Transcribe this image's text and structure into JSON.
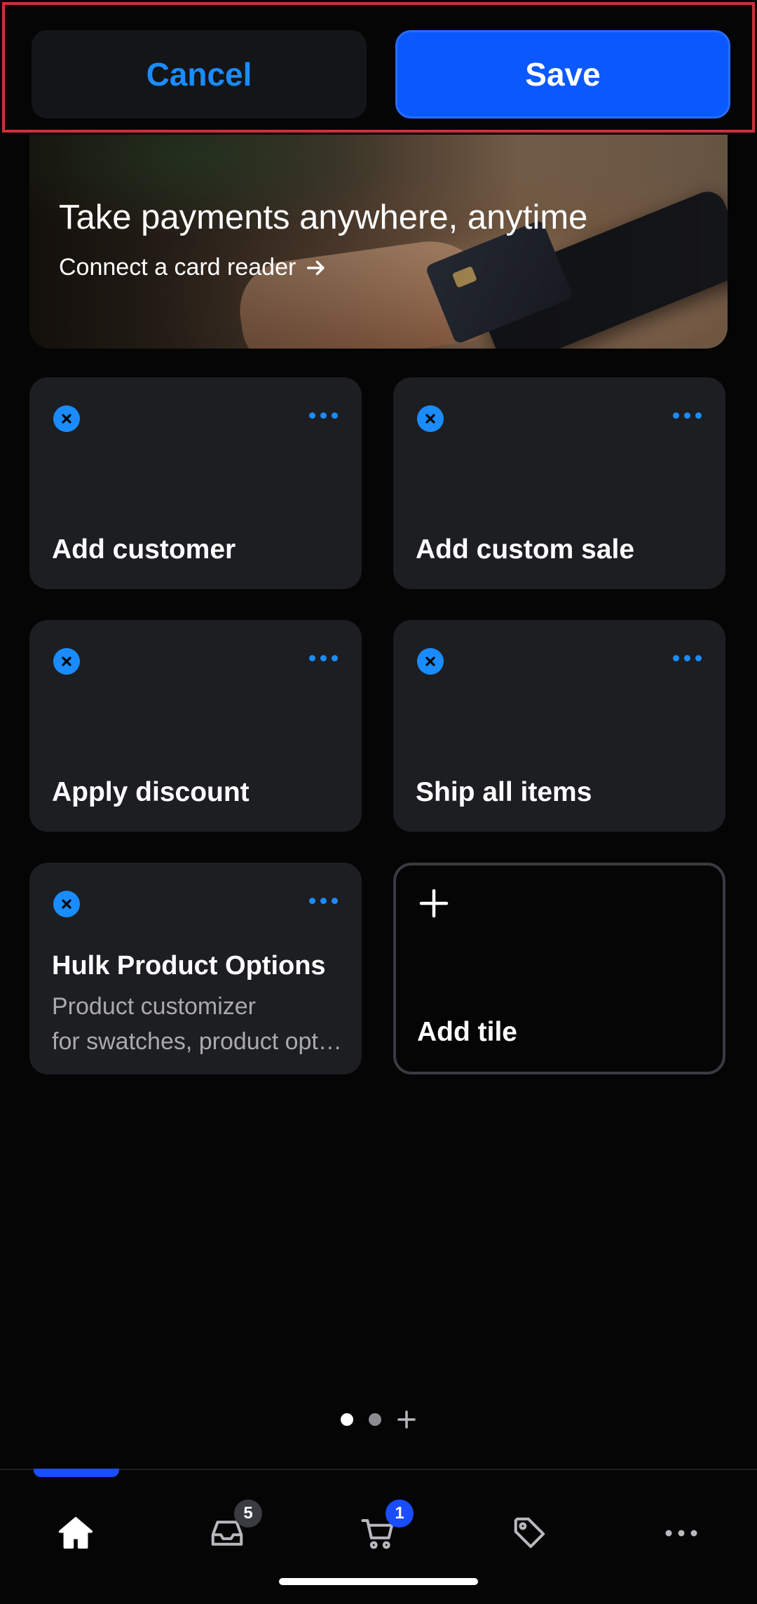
{
  "top_bar": {
    "cancel_label": "Cancel",
    "save_label": "Save"
  },
  "banner": {
    "title": "Take payments anywhere, anytime",
    "link_label": "Connect a card reader"
  },
  "tiles": [
    {
      "label": "Add customer"
    },
    {
      "label": "Add custom sale"
    },
    {
      "label": "Apply discount"
    },
    {
      "label": "Ship all items"
    },
    {
      "title": "Hulk Product Options",
      "description_line1": "Product customizer",
      "description_line2": "for swatches, product options and more"
    }
  ],
  "add_tile": {
    "label": "Add tile"
  },
  "bottom_nav": {
    "items": [
      {
        "icon": "home-icon",
        "badge": ""
      },
      {
        "icon": "inbox-icon",
        "badge": "5"
      },
      {
        "icon": "cart-icon",
        "badge": "1"
      },
      {
        "icon": "tag-icon",
        "badge": ""
      },
      {
        "icon": "more-icon",
        "badge": ""
      }
    ]
  },
  "colors": {
    "accent": "#1a8cff",
    "save_button": "#0a59ff",
    "highlight_border": "#d22d3a",
    "tile_background": "#1d1e22"
  }
}
